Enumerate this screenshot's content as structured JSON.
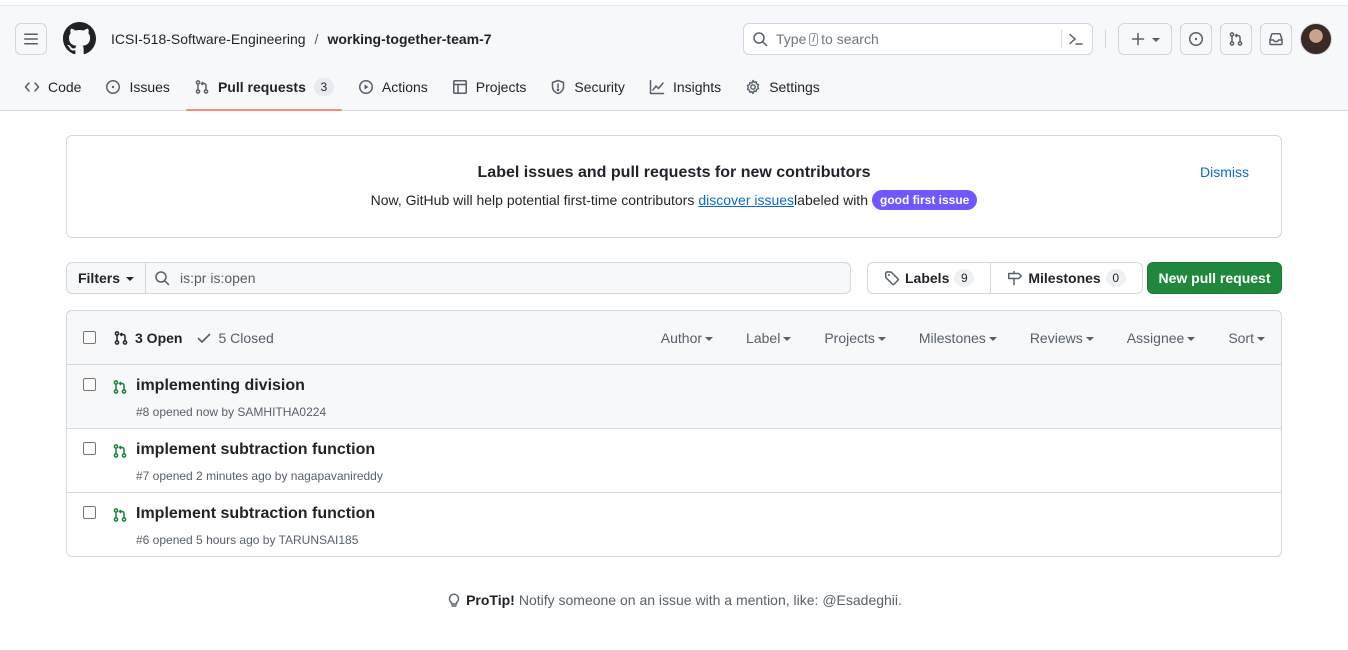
{
  "header": {
    "org": "ICSI-518-Software-Engineering",
    "separator": "/",
    "repo": "working-together-team-7",
    "search": {
      "prefix": "Type",
      "key": "/",
      "suffix": "to search"
    }
  },
  "tabs": [
    {
      "label": "Code",
      "icon": "code-icon"
    },
    {
      "label": "Issues",
      "icon": "issue-opened-icon"
    },
    {
      "label": "Pull requests",
      "icon": "git-pull-request-icon",
      "count": "3",
      "active": true
    },
    {
      "label": "Actions",
      "icon": "play-icon"
    },
    {
      "label": "Projects",
      "icon": "table-icon"
    },
    {
      "label": "Security",
      "icon": "shield-icon"
    },
    {
      "label": "Insights",
      "icon": "graph-icon"
    },
    {
      "label": "Settings",
      "icon": "gear-icon"
    }
  ],
  "banner": {
    "title": "Label issues and pull requests for new contributors",
    "text_before": "Now, GitHub will help potential first-time contributors",
    "link": "discover issues",
    "text_after": "labeled with",
    "label": "good first issue",
    "label_color": "#7057ff",
    "dismiss": "Dismiss"
  },
  "filter_bar": {
    "filters_label": "Filters",
    "query": "is:pr is:open",
    "labels_label": "Labels",
    "labels_count": "9",
    "milestones_label": "Milestones",
    "milestones_count": "0",
    "new_pr_label": "New pull request",
    "accent": "#1f883d"
  },
  "list": {
    "open_label": "3 Open",
    "closed_label": "5 Closed",
    "menus": [
      "Author",
      "Label",
      "Projects",
      "Milestones",
      "Reviews",
      "Assignee",
      "Sort"
    ],
    "items": [
      {
        "title": "implementing division",
        "meta": "#8 opened now by SAMHITHA0224"
      },
      {
        "title": "implement subtraction function",
        "meta": "#7 opened 2 minutes ago by nagapavanireddy"
      },
      {
        "title": "Implement subtraction function",
        "meta": "#6 opened 5 hours ago by TARUNSAI185"
      }
    ]
  },
  "protip": {
    "label": "ProTip!",
    "text": "Notify someone on an issue with a mention, like: @Esadeghii."
  }
}
